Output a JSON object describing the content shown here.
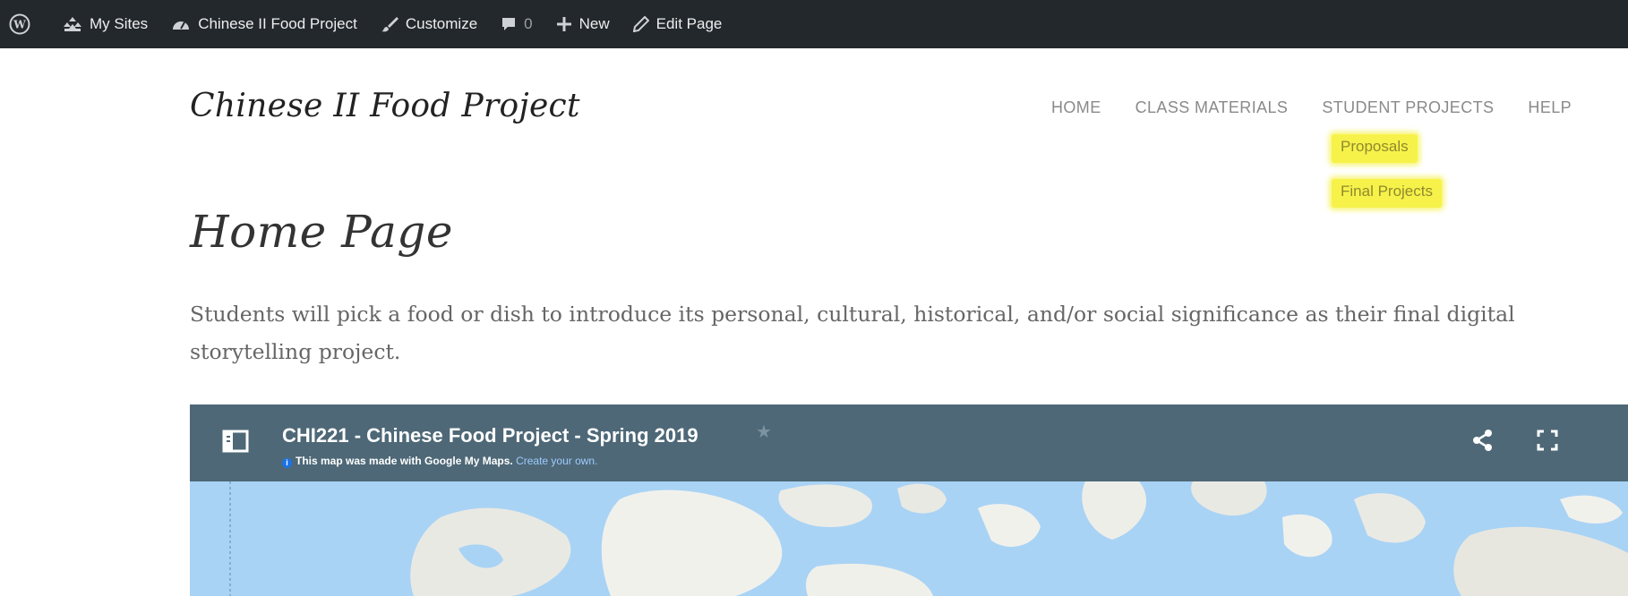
{
  "admin_bar": {
    "my_sites": "My Sites",
    "site_name": "Chinese II Food Project",
    "customize": "Customize",
    "comments_count": "0",
    "new": "New",
    "edit_page": "Edit Page"
  },
  "site": {
    "title": "Chinese II Food Project",
    "nav": [
      "HOME",
      "CLASS MATERIALS",
      "STUDENT PROJECTS",
      "HELP"
    ],
    "submenu": [
      "Proposals",
      "Final Projects"
    ],
    "highlight_color": "#f6f24a"
  },
  "page": {
    "title": "Home Page",
    "intro": "Students will pick a food or dish to introduce its personal, cultural, historical, and/or social significance as their final digital storytelling project."
  },
  "map": {
    "title": "CHI221 - Chinese Food Project - Spring 2019",
    "notice": "This map was made with Google My Maps.",
    "create_link": "Create your own.",
    "header_color": "#4e6877",
    "water_color": "#a9d3f5"
  }
}
